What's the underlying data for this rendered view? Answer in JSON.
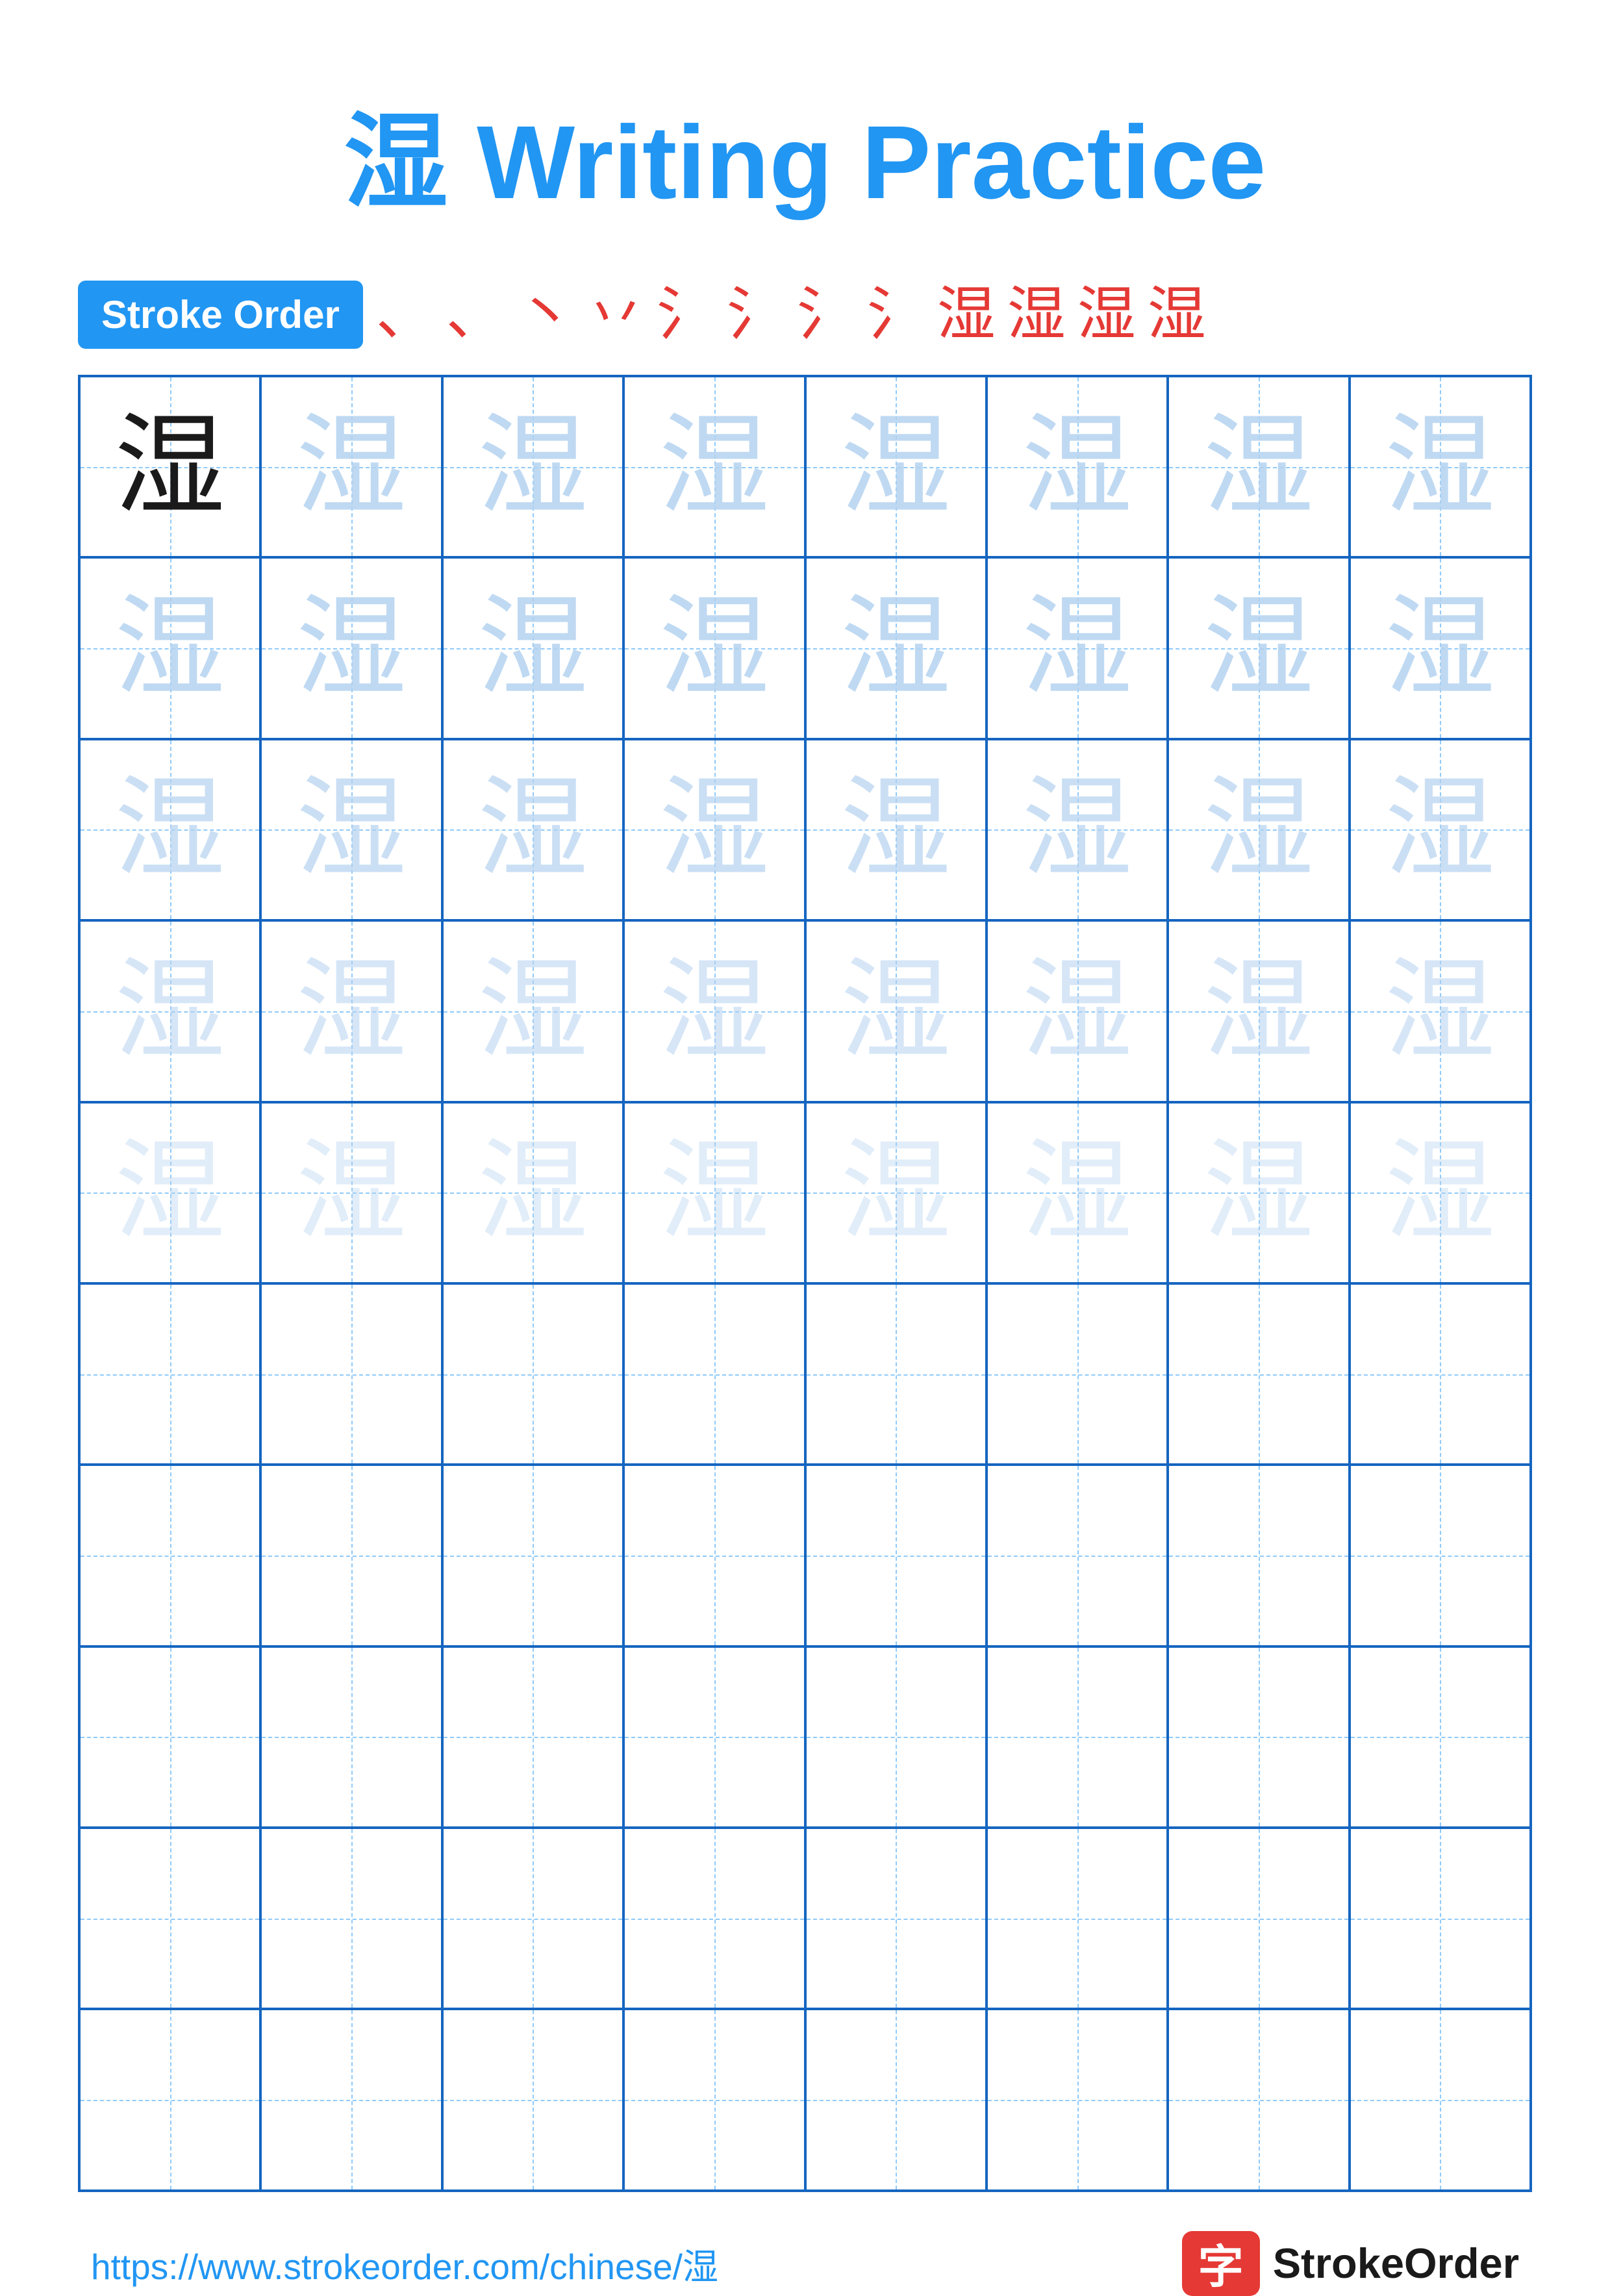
{
  "title": {
    "char": "湿",
    "text": "Writing Practice",
    "full": "湿 Writing Practice"
  },
  "stroke_order": {
    "badge_label": "Stroke Order",
    "strokes": [
      "㇀",
      "㇀",
      "㇀",
      "㇀",
      "氵",
      "氵",
      "氵",
      "氵",
      "湿",
      "湿",
      "湿",
      "湿"
    ]
  },
  "character": "湿",
  "grid": {
    "cols": 8,
    "rows": 10,
    "practice_char": "湿"
  },
  "footer": {
    "url": "https://www.strokeorder.com/chinese/湿",
    "logo_char": "字",
    "logo_text": "StrokeOrder"
  }
}
